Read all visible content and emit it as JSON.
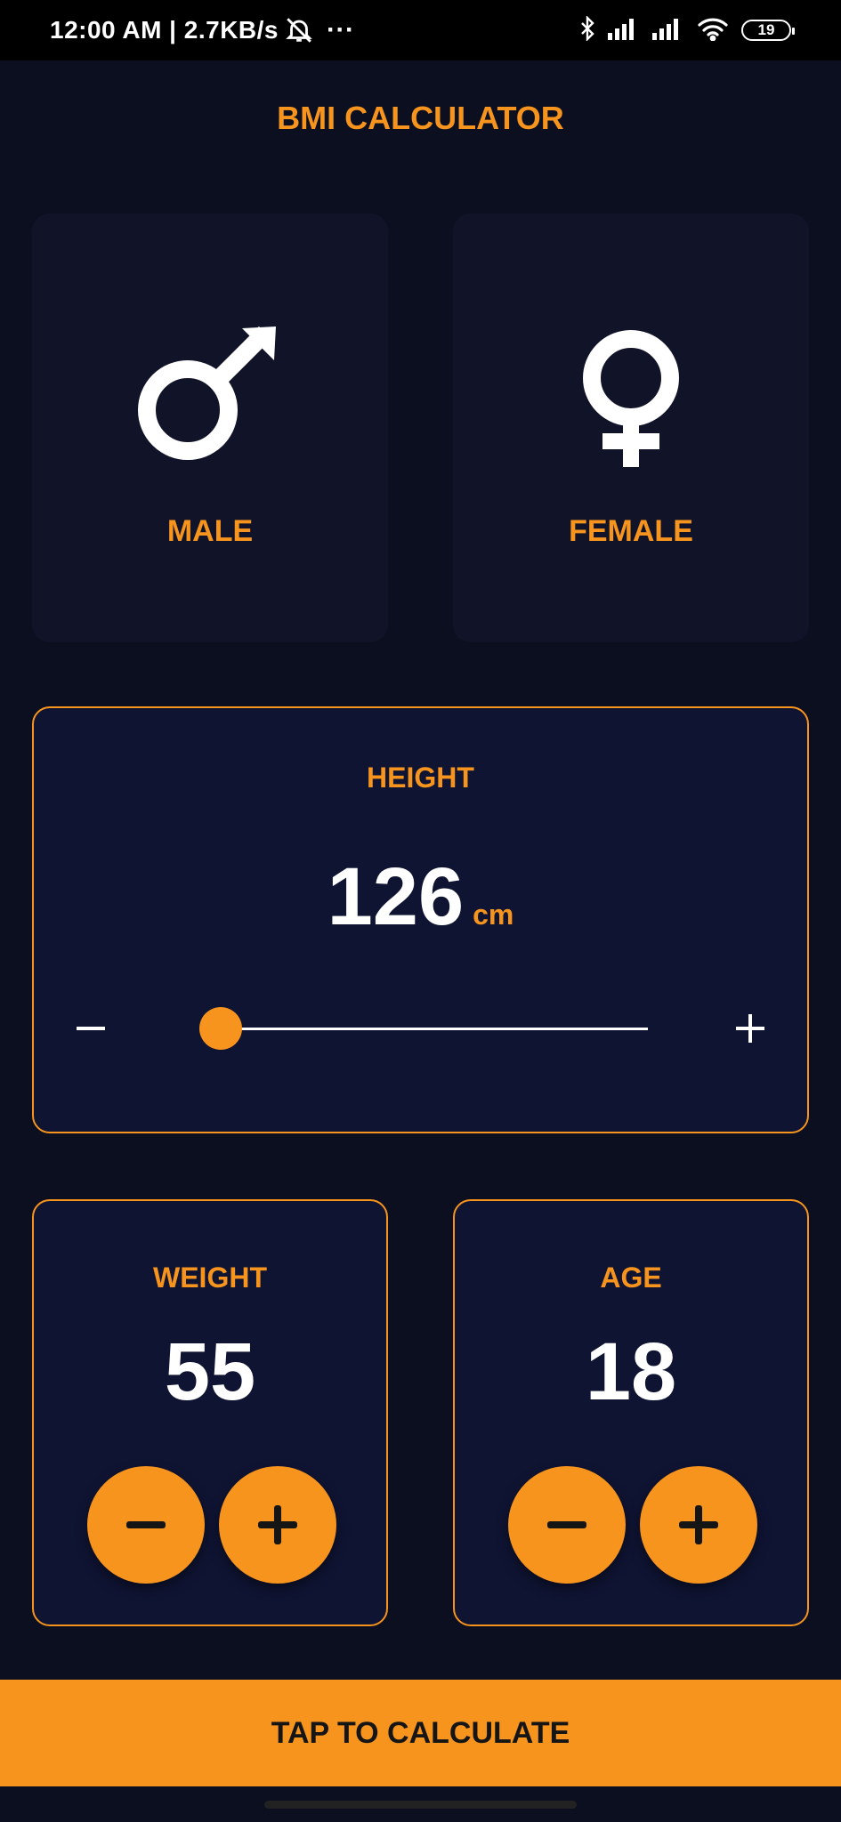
{
  "status_bar": {
    "time_and_speed": "12:00 AM | 2.7KB/s",
    "more": "···",
    "battery_level": "19",
    "icons": [
      "bell-off-icon",
      "bluetooth-icon",
      "signal-icon",
      "signal-icon",
      "wifi-icon",
      "battery-icon"
    ]
  },
  "app": {
    "title": "BMI CALCULATOR"
  },
  "gender": {
    "male": {
      "label": "MALE",
      "icon": "male-icon"
    },
    "female": {
      "label": "FEMALE",
      "icon": "female-icon"
    }
  },
  "height": {
    "label": "HEIGHT",
    "value": "126",
    "unit": "cm",
    "slider_fraction": 0.04
  },
  "weight": {
    "label": "WEIGHT",
    "value": "55"
  },
  "age": {
    "label": "AGE",
    "value": "18"
  },
  "calculate": {
    "label": "TAP TO CALCULATE"
  },
  "colors": {
    "accent": "#f7941d",
    "background": "#0b0f1f",
    "card": "#111428",
    "card_active": "#0f1433",
    "text": "#ffffff"
  }
}
